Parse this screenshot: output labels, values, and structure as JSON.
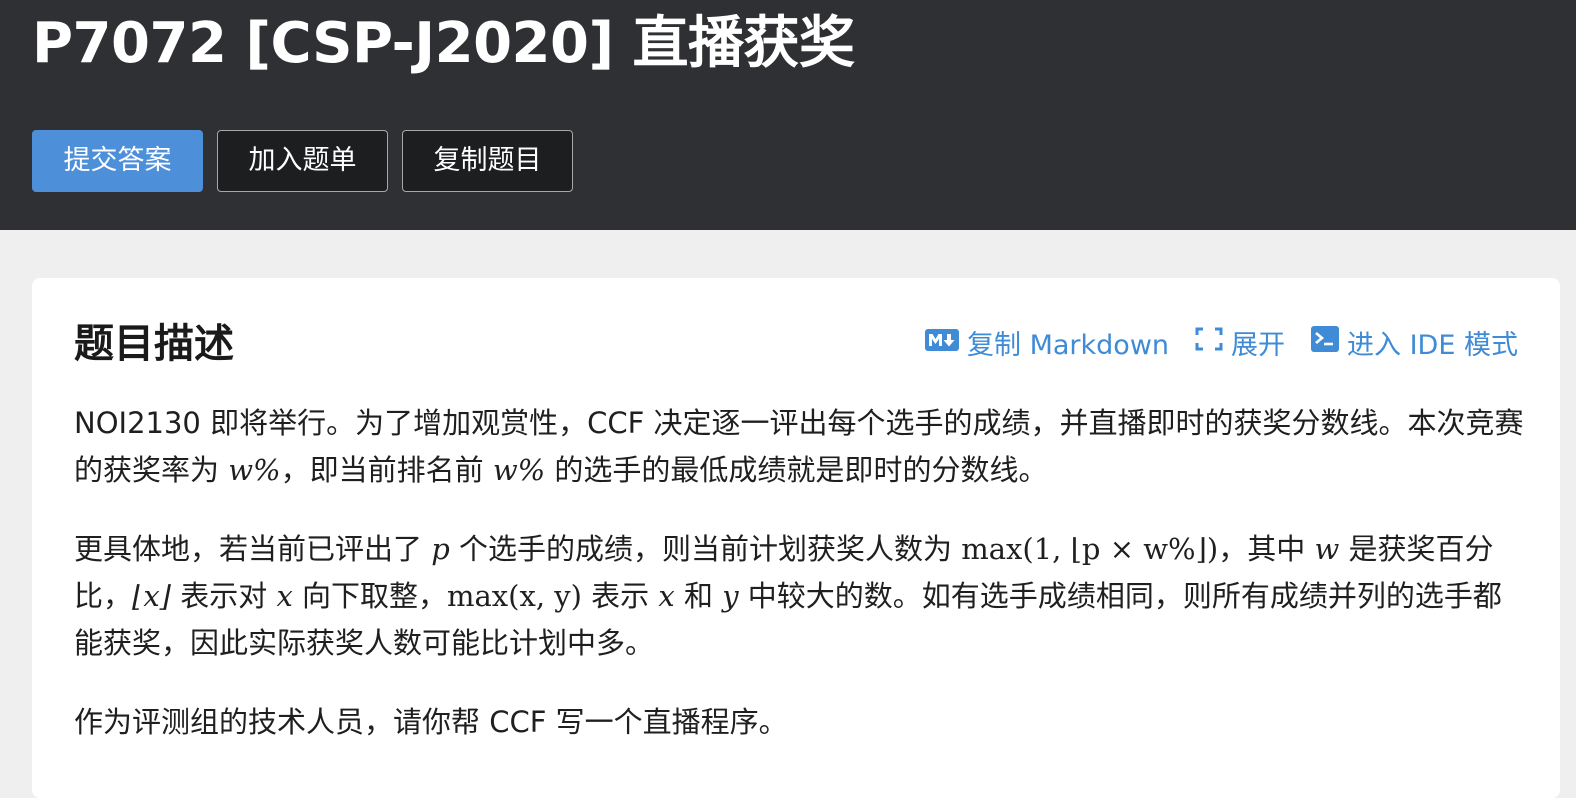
{
  "header": {
    "title": "P7072 [CSP-J2020] 直播获奖",
    "buttons": {
      "submit": "提交答案",
      "add_to_list": "加入题单",
      "copy_problem": "复制题目"
    }
  },
  "section": {
    "title": "题目描述",
    "actions": {
      "copy_markdown": "复制 Markdown",
      "expand": "展开",
      "ide_mode": "进入 IDE 模式"
    }
  },
  "paragraphs": {
    "p1": {
      "a": "NOI2130 即将举行。为了增加观赏性，CCF 决定逐一评出每个选手的成绩，并直播即时的获奖分数线。本次竞赛的获奖率为 ",
      "m1": "w%",
      "b": "，即当前排名前 ",
      "m2": "w%",
      "c": " 的选手的最低成绩就是即时的分数线。"
    },
    "p2": {
      "a": "更具体地，若当前已评出了 ",
      "m1": "p",
      "b": " 个选手的成绩，则当前计划获奖人数为 ",
      "m2": "max(1, ⌊p × w%⌋)",
      "c": "，其中 ",
      "m3": "w",
      "d": " 是获奖百分比，",
      "m4": "⌊x⌋",
      "e": " 表示对 ",
      "m5": "x",
      "f": " 向下取整，",
      "m6": "max(x, y)",
      "g": " 表示 ",
      "m7": "x",
      "h": " 和 ",
      "m8": "y",
      "i": " 中较大的数。如有选手成绩相同，则所有成绩并列的选手都能获奖，因此实际获奖人数可能比计划中多。"
    },
    "p3": "作为评测组的技术人员，请你帮 CCF 写一个直播程序。"
  },
  "icons": {
    "markdown": "markdown-icon",
    "expand": "expand-icon",
    "terminal": "terminal-icon"
  },
  "colors": {
    "header_bg": "#2f3033",
    "primary": "#4d8fd9",
    "link": "#3f8bd6",
    "page_bg": "#efefef"
  }
}
